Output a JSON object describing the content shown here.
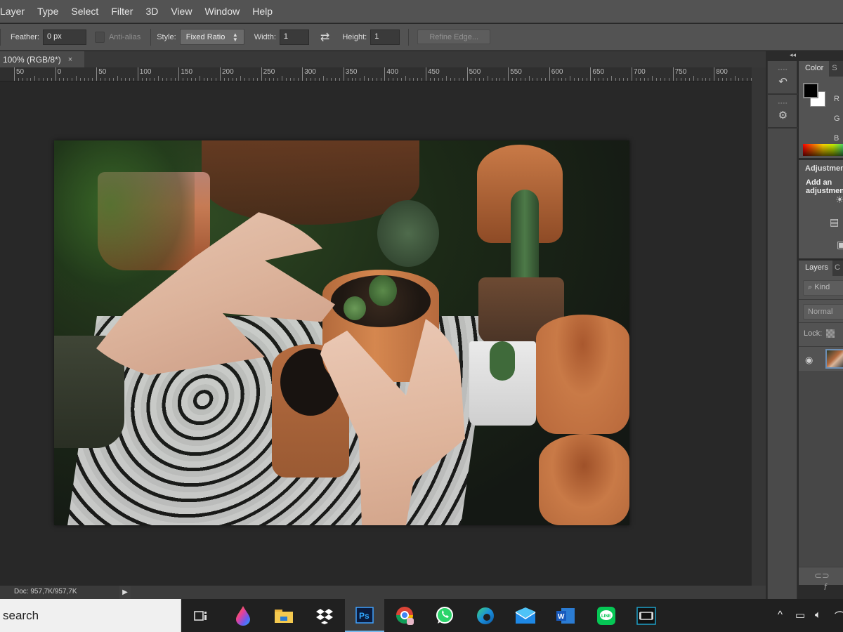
{
  "menubar": {
    "items": [
      "Layer",
      "Type",
      "Select",
      "Filter",
      "3D",
      "View",
      "Window",
      "Help"
    ]
  },
  "options": {
    "feather_label": "Feather:",
    "feather_value": "0 px",
    "antialias_label": "Anti-alias",
    "antialias_checked": false,
    "style_label": "Style:",
    "style_value": "Fixed Ratio",
    "width_label": "Width:",
    "width_value": "1",
    "swap_icon": "swap-arrows-icon",
    "height_label": "Height:",
    "height_value": "1",
    "refine_edge_label": "Refine Edge..."
  },
  "document": {
    "tab_label": "100% (RGB/8*)",
    "close_glyph": "×"
  },
  "ruler": {
    "labels": [
      "50",
      "0",
      "50",
      "100",
      "150",
      "200",
      "250",
      "300",
      "350",
      "400",
      "450",
      "500",
      "550",
      "600",
      "650",
      "700",
      "750",
      "800"
    ]
  },
  "canvas": {
    "image_description": "Hands potting a small cactus in a terracotta pot, surrounded by other terracotta pots and plants"
  },
  "status": {
    "doc_size": "Doc: 957,7K/957,7K",
    "menu_arrow": "▶"
  },
  "dock": {
    "collapse_glyph": "◂◂"
  },
  "color_panel": {
    "tabs": [
      "Color",
      "S"
    ],
    "labels": [
      "R",
      "G",
      "B"
    ],
    "foreground": "#000000",
    "background": "#ffffff"
  },
  "adjustments_panel": {
    "title": "Adjustments",
    "subtitle": "Add an adjustment"
  },
  "layers_panel": {
    "tabs": [
      "Layers",
      "C"
    ],
    "kind_placeholder": "Kind",
    "blend_mode": "Normal",
    "lock_label": "Lock:"
  },
  "taskbar": {
    "search_placeholder": "search",
    "apps": [
      "task-view",
      "paint",
      "file-explorer",
      "dropbox",
      "photoshop",
      "chrome",
      "whatsapp",
      "edge",
      "mail",
      "word",
      "line",
      "movie-maker"
    ],
    "active_app": "photoshop",
    "tray": [
      "show-hidden-icons",
      "network",
      "volume"
    ]
  }
}
